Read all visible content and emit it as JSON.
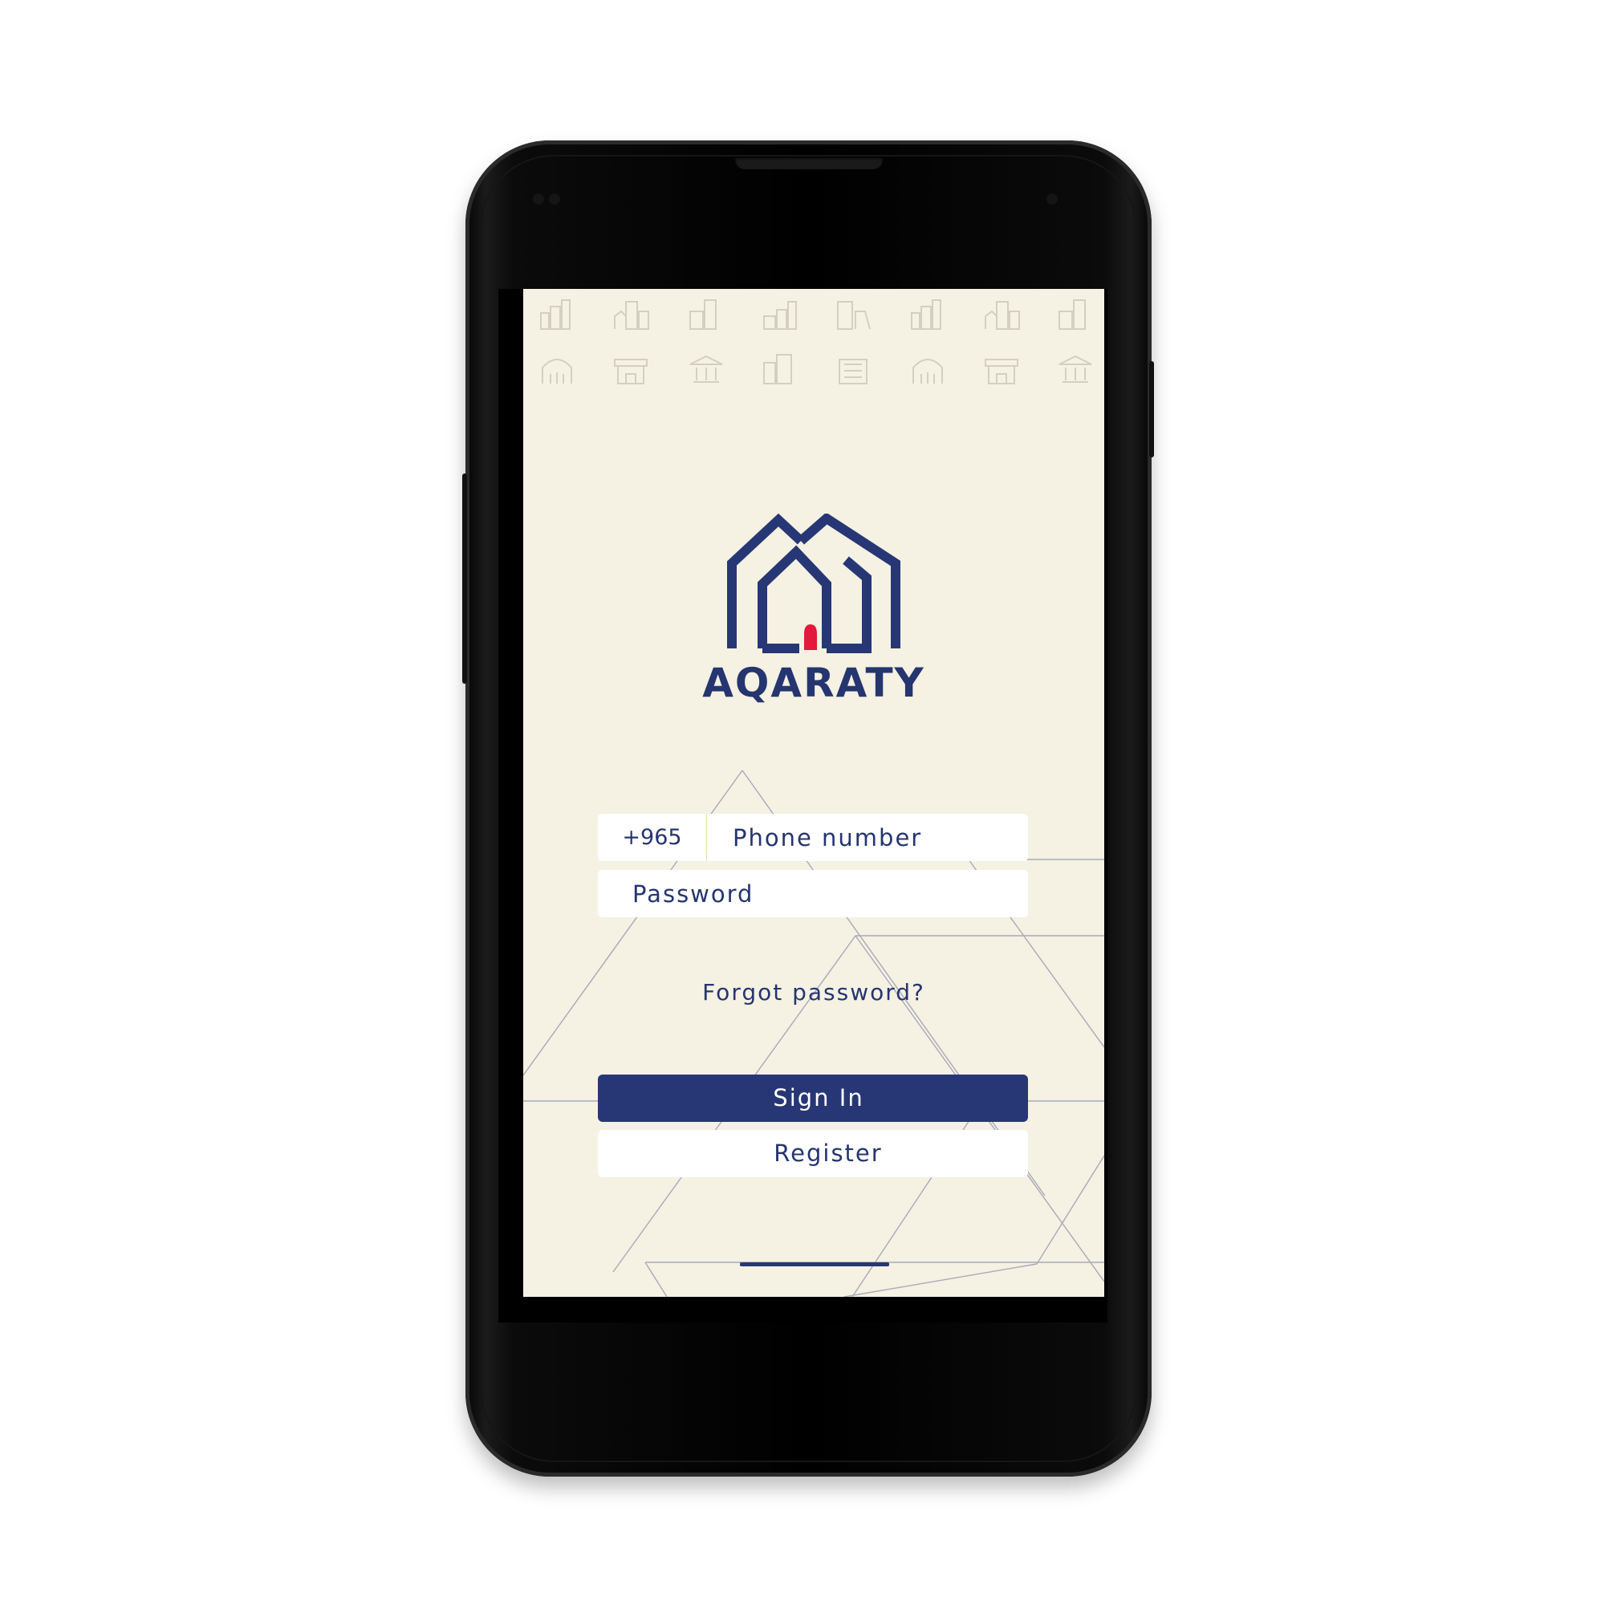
{
  "brand": {
    "name": "AQARATY",
    "logo": "house-a-logo",
    "colors": {
      "navy": "#273775",
      "accent_red": "#e3193d",
      "cream": "#f5f1e3"
    }
  },
  "header_icons": {
    "row1": [
      "city-icon",
      "apartments-icon",
      "tower-icon",
      "skyline-icon",
      "office-building-icon",
      "city-icon",
      "apartments-icon",
      "tower-icon"
    ],
    "row2": [
      "mosque-icon",
      "fort-icon",
      "museum-icon",
      "building-icon",
      "skyscraper-icon",
      "mosque-icon",
      "fort-icon",
      "museum-icon"
    ]
  },
  "login": {
    "country_code": "+965",
    "phone_placeholder": "Phone number",
    "password_placeholder": "Password",
    "forgot_password": "Forgot password?",
    "sign_in": "Sign In",
    "register": "Register"
  }
}
